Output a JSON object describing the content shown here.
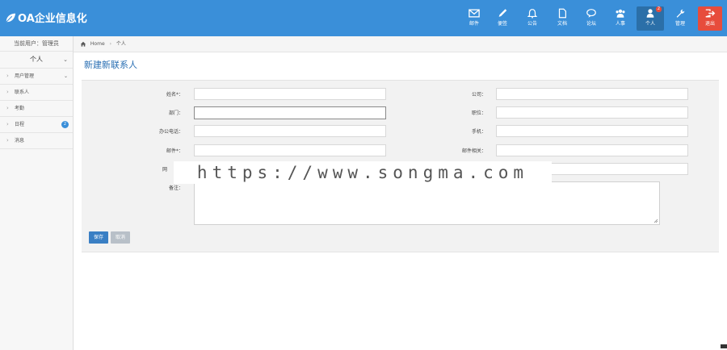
{
  "brand": {
    "name": "OA企业信息化"
  },
  "nav": [
    {
      "key": "mail",
      "label": "邮件"
    },
    {
      "key": "notes",
      "label": "便签"
    },
    {
      "key": "notice",
      "label": "公告"
    },
    {
      "key": "docs",
      "label": "文档"
    },
    {
      "key": "forum",
      "label": "论坛"
    },
    {
      "key": "hr",
      "label": "人事"
    },
    {
      "key": "personal",
      "label": "个人",
      "badge": "2"
    },
    {
      "key": "admin",
      "label": "管理"
    },
    {
      "key": "exit",
      "label": "退出"
    }
  ],
  "sidebar": {
    "user_text": "当前用户：管理员",
    "section": "个人",
    "items": [
      {
        "label": "用户管理",
        "has_chevron": true
      },
      {
        "label": "联系人"
      },
      {
        "label": "考勤"
      },
      {
        "label": "日程",
        "count": "2"
      },
      {
        "label": "消息"
      }
    ]
  },
  "breadcrumb": {
    "home": "Home",
    "sep": "›",
    "current": "个人"
  },
  "page_title": "新建新联系人",
  "form": {
    "name_label": "姓名*：",
    "company_label": "公司：",
    "dept_label": "部门：",
    "position_label": "职位：",
    "office_phone_label": "办公电话：",
    "mobile_label": "手机：",
    "email_label": "邮件*：",
    "email2_label": "邮件相关：",
    "web_label": "网",
    "notes_label": "备注："
  },
  "buttons": {
    "save": "保存",
    "cancel": "取消"
  },
  "watermark": "https://www.songma.com",
  "colors": {
    "topbar": "#3a8fd9",
    "exit": "#e74c3c",
    "title": "#2a6fb3",
    "save": "#3a7fc4"
  }
}
